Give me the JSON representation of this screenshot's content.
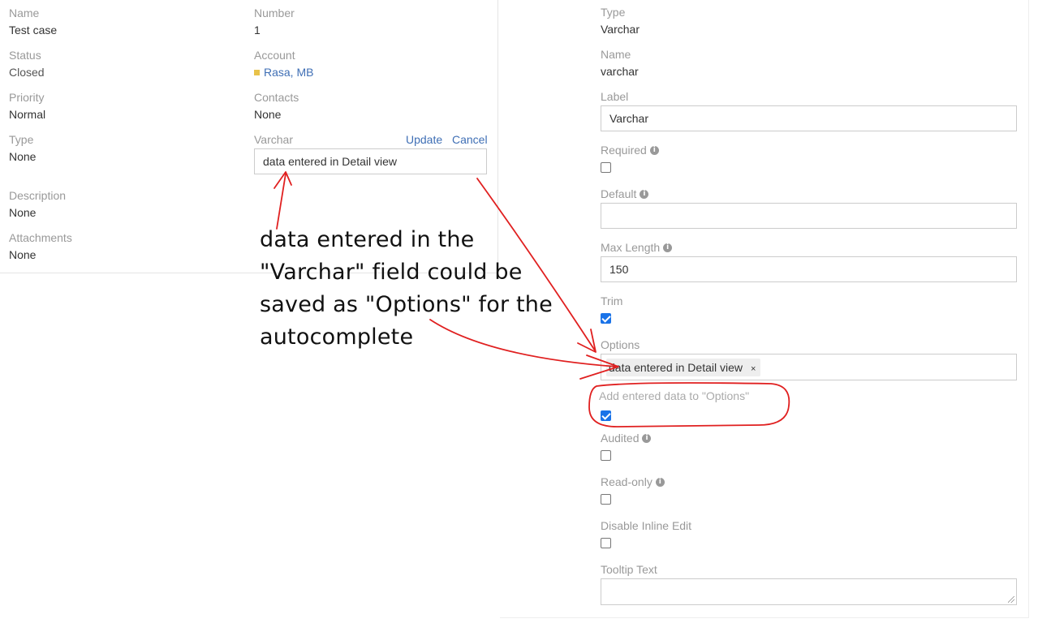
{
  "detail": {
    "name": {
      "label": "Name",
      "value": "Test case"
    },
    "number": {
      "label": "Number",
      "value": "1"
    },
    "status": {
      "label": "Status",
      "value": "Closed"
    },
    "account": {
      "label": "Account",
      "value": "Rasa, MB"
    },
    "priority": {
      "label": "Priority",
      "value": "Normal"
    },
    "contacts": {
      "label": "Contacts",
      "value": "None"
    },
    "type": {
      "label": "Type",
      "value": "None"
    },
    "varchar": {
      "label": "Varchar",
      "input_value": "data entered in Detail view",
      "update_label": "Update",
      "cancel_label": "Cancel"
    },
    "description": {
      "label": "Description",
      "value": "None"
    },
    "attachments": {
      "label": "Attachments",
      "value": "None"
    }
  },
  "field_manager": {
    "type": {
      "label": "Type",
      "value": "Varchar"
    },
    "name": {
      "label": "Name",
      "value": "varchar"
    },
    "label": {
      "label": "Label",
      "value": "Varchar"
    },
    "required": {
      "label": "Required",
      "checked": false
    },
    "default": {
      "label": "Default",
      "value": ""
    },
    "max_length": {
      "label": "Max Length",
      "value": "150"
    },
    "trim": {
      "label": "Trim",
      "checked": true
    },
    "options": {
      "label": "Options",
      "tags": [
        "data entered in Detail view"
      ],
      "remove_glyph": "×"
    },
    "add_entered": {
      "label": "Add entered data to \"Options\"",
      "checked": true
    },
    "audited": {
      "label": "Audited",
      "checked": false
    },
    "read_only": {
      "label": "Read-only",
      "checked": false
    },
    "disable_inline_edit": {
      "label": "Disable Inline Edit",
      "checked": false
    },
    "tooltip_text": {
      "label": "Tooltip Text",
      "value": ""
    }
  },
  "annotation": {
    "lines": [
      "data entered in the",
      "\"Varchar\" field could be",
      "saved as \"Options\" for the",
      "autocomplete"
    ],
    "color": "#e02020"
  },
  "colors": {
    "link": "#3f6fb5",
    "label": "#999999",
    "checkbox_checked": "#1a73e8",
    "account_marker": "#e8c24a"
  },
  "icons": {
    "info": "info-icon",
    "tag_remove": "close-icon"
  }
}
